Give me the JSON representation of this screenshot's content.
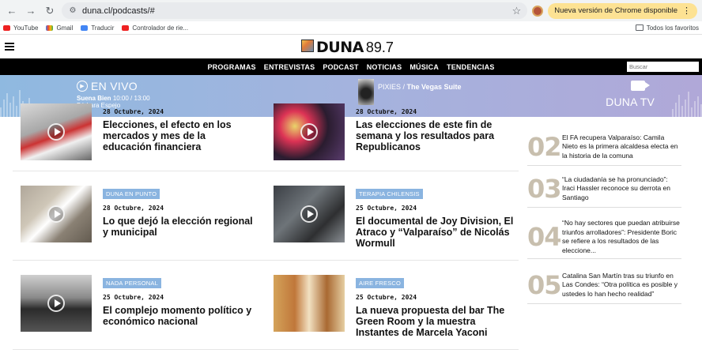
{
  "browser": {
    "url": "duna.cl/podcasts/#",
    "update_label": "Nueva versión de Chrome disponible",
    "bookmarks": [
      "YouTube",
      "Gmail",
      "Traducir",
      "Controlador de rie..."
    ],
    "favorites_label": "Todos los favoritos"
  },
  "site": {
    "logo_text": "DUNA",
    "logo_freq": "89.7",
    "nav": [
      "PROGRAMAS",
      "ENTREVISTAS",
      "PODCAST",
      "NOTICIAS",
      "MÚSICA",
      "TENDENCIAS"
    ],
    "search_placeholder": "Buscar"
  },
  "live": {
    "label": "EN VIVO",
    "show": "Suena Bien",
    "time": "10:00 / 13:00",
    "host": "Bárbara Espejo",
    "artist": "PIXIES",
    "song": "The Vegas Suite",
    "tv_label": "DUNA TV"
  },
  "articles": [
    {
      "date": "28 Octubre, 2024",
      "title": "Elecciones, el efecto en los mercados y mes de la educación financiera"
    },
    {
      "date": "28 Octubre, 2024",
      "title": "Las elecciones de este fin de semana y los resultados para Republicanos"
    },
    {
      "category": "DUNA EN PUNTO",
      "date": "28 Octubre, 2024",
      "title": "Lo que dejó la elección regional y municipal"
    },
    {
      "category": "TERAPIA CHILENSIS",
      "date": "25 Octubre, 2024",
      "title": "El documental de Joy Division, El Atraco y “Valparaíso” de Nicolás Wormull"
    },
    {
      "category": "NADA PERSONAL",
      "date": "25 Octubre, 2024",
      "title": "El complejo momento político y económico nacional"
    },
    {
      "category": "AIRE FRESCO",
      "date": "25 Octubre, 2024",
      "title": "La nueva propuesta del bar The Green Room y la muestra Instantes de Marcela Yaconi"
    }
  ],
  "sidebar": [
    {
      "num": "02",
      "text": "El FA recupera Valparaíso: Camila Nieto es la primera alcaldesa electa en la historia de la comuna"
    },
    {
      "num": "03",
      "text": "“La ciudadanía se ha pronunciado”: Iraci Hassler reconoce su derrota en Santiago"
    },
    {
      "num": "04",
      "text": "“No hay sectores que puedan atribuirse triunfos arrolladores”: Presidente Boric se refiere a los resultados de las eleccione..."
    },
    {
      "num": "05",
      "text": "Catalina San Martín tras su triunfo en Las Condes: “Otra política es posible y ustedes lo han hecho realidad”"
    }
  ]
}
